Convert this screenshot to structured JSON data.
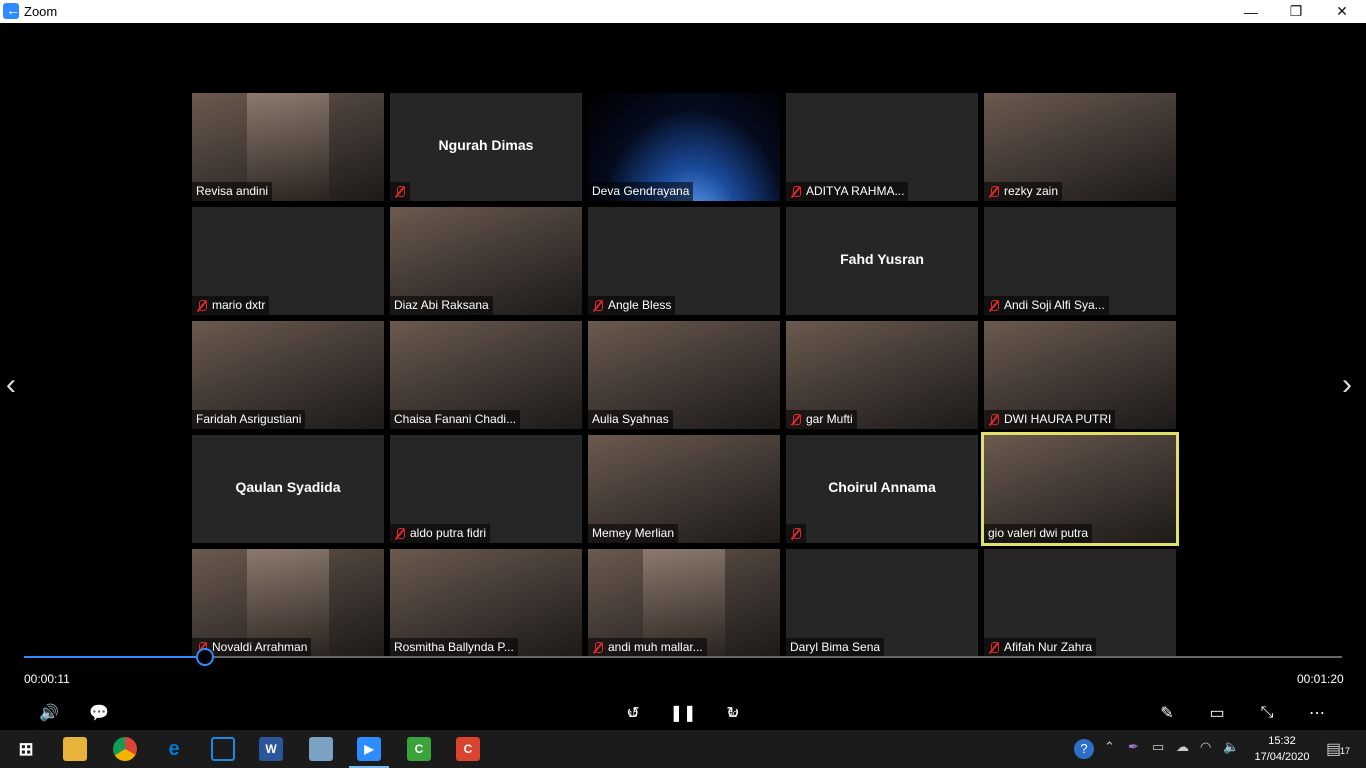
{
  "window": {
    "title": "Zoom",
    "back_glyph": "←",
    "minimize": "—",
    "restore": "❐",
    "close": "✕"
  },
  "participants": [
    {
      "name": "Revisa andini",
      "muted": false,
      "kind": "narrow"
    },
    {
      "name": "Ngurah Dimas",
      "muted": true,
      "kind": "name-only"
    },
    {
      "name": "Deva Gendrayana",
      "muted": false,
      "kind": "space"
    },
    {
      "name": "ADITYA RAHMA...",
      "muted": true,
      "kind": "blank"
    },
    {
      "name": "rezky zain",
      "muted": true,
      "kind": "video"
    },
    {
      "name": "mario dxtr",
      "muted": true,
      "kind": "blank"
    },
    {
      "name": "Diaz Abi Raksana",
      "muted": false,
      "kind": "video"
    },
    {
      "name": "Angle Bless",
      "muted": true,
      "kind": "blank"
    },
    {
      "name": "Fahd Yusran",
      "muted": false,
      "kind": "name-only-nolabel"
    },
    {
      "name": "Andi Soji Alfi Sya...",
      "muted": true,
      "kind": "blank"
    },
    {
      "name": "Faridah Asrigustiani",
      "muted": false,
      "kind": "video"
    },
    {
      "name": "Chaisa Fanani Chadi...",
      "muted": false,
      "kind": "video"
    },
    {
      "name": "Aulia Syahnas",
      "muted": false,
      "kind": "video"
    },
    {
      "name": "gar Mufti",
      "muted": true,
      "kind": "video"
    },
    {
      "name": "DWI HAURA PUTRI",
      "muted": true,
      "kind": "video"
    },
    {
      "name": "Qaulan Syadida",
      "muted": false,
      "kind": "name-only-nolabel"
    },
    {
      "name": "aldo putra fidri",
      "muted": true,
      "kind": "blank"
    },
    {
      "name": "Memey Merlian",
      "muted": false,
      "kind": "video"
    },
    {
      "name": "Choirul Annama",
      "muted": true,
      "kind": "name-only"
    },
    {
      "name": "gio valeri dwi putra",
      "muted": false,
      "kind": "video",
      "active": true
    },
    {
      "name": "Novaldi Arrahman",
      "muted": true,
      "kind": "narrow"
    },
    {
      "name": "Rosmitha Ballynda P...",
      "muted": false,
      "kind": "video"
    },
    {
      "name": "andi muh mallar...",
      "muted": true,
      "kind": "narrow"
    },
    {
      "name": "Daryl Bima Sena",
      "muted": false,
      "kind": "blank"
    },
    {
      "name": "Afifah Nur Zahra",
      "muted": true,
      "kind": "blank"
    }
  ],
  "player": {
    "elapsed": "00:00:11",
    "duration": "00:01:20",
    "progress": 0.1375,
    "icons": {
      "volume": "🔊",
      "captions": "💬",
      "rewind": "↺",
      "rewind_label": "10",
      "pause": "❚❚",
      "forward": "↻",
      "forward_label": "30",
      "pen": "✎",
      "pip": "▭",
      "exit_fullscreen": "⤡",
      "more": "⋯"
    },
    "nav": {
      "prev": "‹",
      "next": "›"
    }
  },
  "taskbar": {
    "time": "15:32",
    "date": "17/04/2020",
    "notification_count": "17",
    "apps": [
      "start",
      "file-explorer",
      "chrome",
      "edge",
      "remote-desktop",
      "word",
      "notepad",
      "zoom",
      "camtasia",
      "camtasia-recorder"
    ],
    "colors": {
      "zoom": "#2d8cff",
      "word": "#2b579a",
      "chrome": "#db4437",
      "edge": "#0078d7",
      "camtasia-green": "#3aa33a",
      "camtasia-red": "#d9432f"
    }
  }
}
